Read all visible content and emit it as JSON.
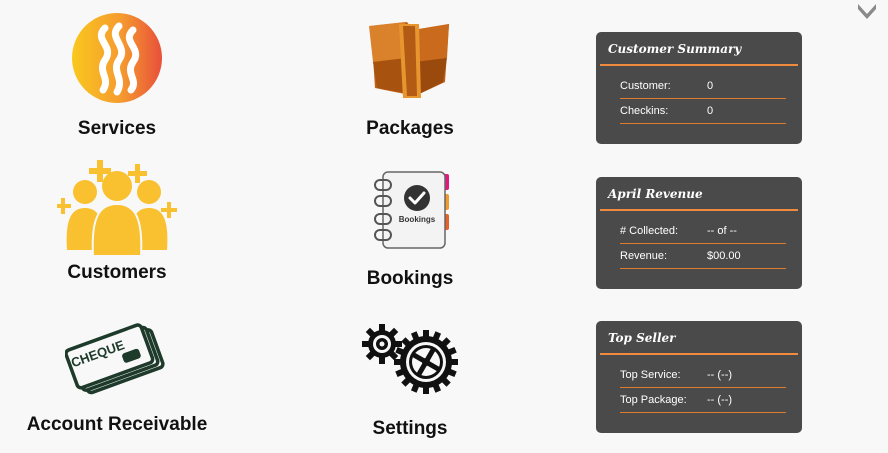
{
  "tiles": [
    {
      "key": "services",
      "label": "Services",
      "icon": "services-icon"
    },
    {
      "key": "packages",
      "label": "Packages",
      "icon": "packages-icon"
    },
    {
      "key": "customers",
      "label": "Customers",
      "icon": "customers-icon"
    },
    {
      "key": "bookings",
      "label": "Bookings",
      "icon": "bookings-icon",
      "icon_text": "Bookings"
    },
    {
      "key": "account_receivable",
      "label": "Account Receivable",
      "icon": "cheque-icon",
      "icon_text": "CHEQUE"
    },
    {
      "key": "settings",
      "label": "Settings",
      "icon": "gears-icon"
    }
  ],
  "cards": {
    "customer_summary": {
      "title": "Customer Summary",
      "rows": [
        {
          "label": "Customer:",
          "value": "0"
        },
        {
          "label": "Checkins:",
          "value": "0"
        }
      ]
    },
    "revenue": {
      "title": "April Revenue",
      "rows": [
        {
          "label": "# Collected:",
          "value": "-- of --"
        },
        {
          "label": "Revenue:",
          "value": "$00.00"
        }
      ]
    },
    "top_seller": {
      "title": "Top Seller",
      "rows": [
        {
          "label": "Top Service:",
          "value": "-- (--)"
        },
        {
          "label": "Top Package:",
          "value": "-- (--)"
        }
      ]
    }
  },
  "colors": {
    "card_bg": "#4a4a4a",
    "accent": "#f08a3c",
    "icon_yellow": "#f9c02f",
    "text": "#111111"
  }
}
